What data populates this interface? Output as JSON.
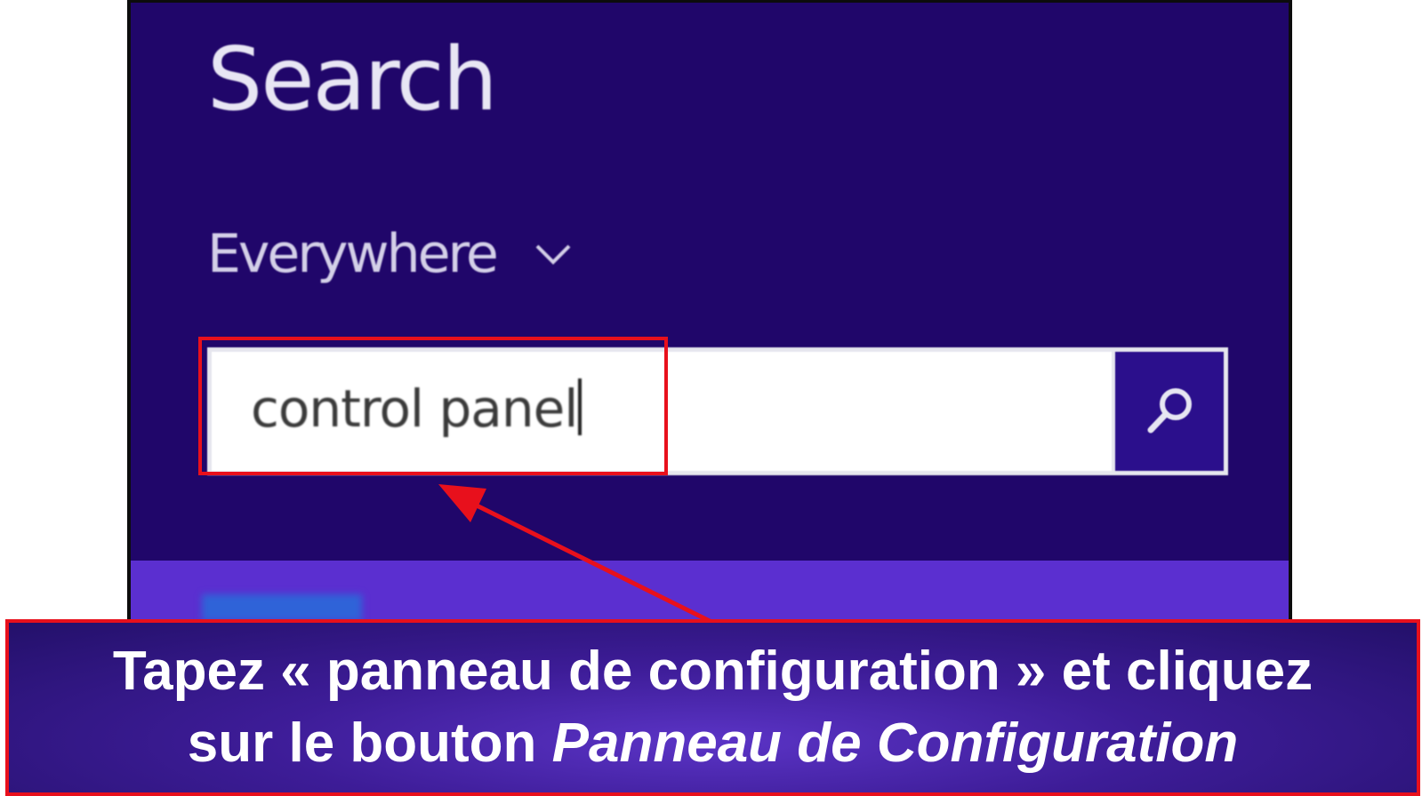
{
  "charm": {
    "title": "Search",
    "scope_label": "Everywhere",
    "scope_icon": "chevron-down-icon",
    "search_query": "control panel",
    "search_button_icon": "magnifier-icon"
  },
  "annotation": {
    "caption_line1": "Tapez « panneau de configuration » et cliquez",
    "caption_line2_plain": "sur le bouton ",
    "caption_line2_italic": "Panneau de Configuration",
    "highlight_color": "#e8101c"
  },
  "colors": {
    "charm_background": "#20066a",
    "accent_band": "#5b2fd0",
    "search_button": "#2b0f8c"
  }
}
